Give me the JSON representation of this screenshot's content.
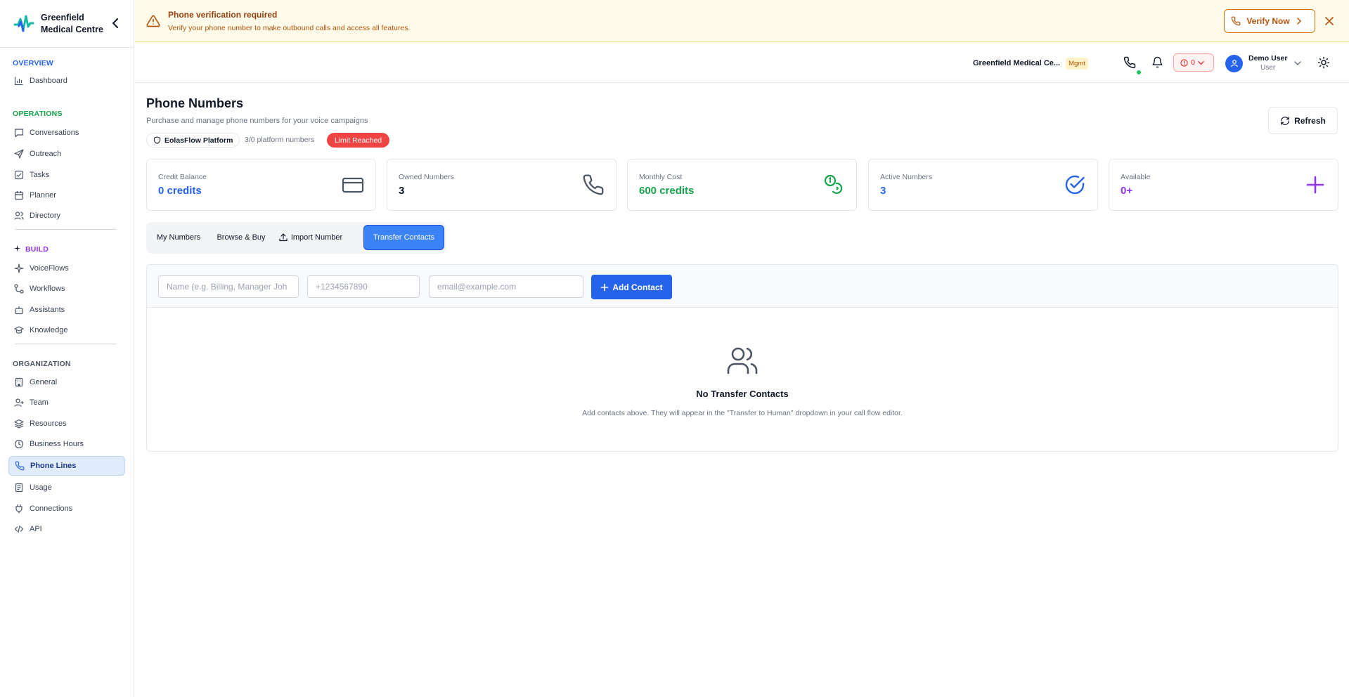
{
  "brand": {
    "name": "Greenfield Medical Centre"
  },
  "sidebar": {
    "sections": {
      "overview": {
        "label": "OVERVIEW",
        "color": "#2563eb"
      },
      "operations": {
        "label": "OPERATIONS",
        "color": "#16a34a"
      },
      "build": {
        "label": "BUILD",
        "color": "#9333ea"
      },
      "organization": {
        "label": "ORGANIZATION",
        "color": "#4b5563"
      }
    },
    "items": [
      {
        "label": "Dashboard",
        "icon": "chart-icon"
      },
      {
        "label": "Conversations",
        "icon": "message-icon"
      },
      {
        "label": "Outreach",
        "icon": "send-icon"
      },
      {
        "label": "Tasks",
        "icon": "checklist-icon"
      },
      {
        "label": "Planner",
        "icon": "calendar-icon"
      },
      {
        "label": "Directory",
        "icon": "users-icon"
      },
      {
        "label": "VoiceFlows",
        "icon": "sparkle-icon"
      },
      {
        "label": "Workflows",
        "icon": "workflow-icon"
      },
      {
        "label": "Assistants",
        "icon": "bot-icon"
      },
      {
        "label": "Knowledge",
        "icon": "graduation-icon"
      },
      {
        "label": "General",
        "icon": "building-icon"
      },
      {
        "label": "Team",
        "icon": "user-plus-icon"
      },
      {
        "label": "Resources",
        "icon": "layers-icon"
      },
      {
        "label": "Business Hours",
        "icon": "clock-icon"
      },
      {
        "label": "Phone Lines",
        "icon": "phone-icon",
        "active": true
      },
      {
        "label": "Usage",
        "icon": "receipt-icon"
      },
      {
        "label": "Connections",
        "icon": "plug-icon"
      },
      {
        "label": "API",
        "icon": "code-icon"
      }
    ]
  },
  "banner": {
    "title": "Phone verification required",
    "description": "Verify your phone number to make outbound calls and access all features.",
    "button": "Verify Now"
  },
  "header": {
    "org_name": "Greenfield Medical Ce...",
    "org_badge": "Mgmt",
    "alerts_count": "0",
    "user_name": "Demo User",
    "user_role": "User"
  },
  "page": {
    "title": "Phone Numbers",
    "subtitle": "Purchase and manage phone numbers for your voice campaigns",
    "platform_badge": "EolasFlow Platform",
    "platform_count": "3/0 platform numbers",
    "limit_badge": "Limit Reached",
    "refresh": "Refresh"
  },
  "stats": [
    {
      "label": "Credit Balance",
      "value": "0 credits",
      "color": "#2563eb",
      "icon": "credit-card-icon"
    },
    {
      "label": "Owned Numbers",
      "value": "3",
      "color": "#111827",
      "icon": "phone-icon"
    },
    {
      "label": "Monthly Cost",
      "value": "600 credits",
      "color": "#16a34a",
      "icon": "coins-icon"
    },
    {
      "label": "Active Numbers",
      "value": "3",
      "color": "#2563eb",
      "icon": "check-circle-icon"
    },
    {
      "label": "Available",
      "value": "0+",
      "color": "#9333ea",
      "icon": "plus-icon"
    }
  ],
  "tabs": [
    {
      "label": "My Numbers"
    },
    {
      "label": "Browse & Buy"
    },
    {
      "label": "Import Number"
    },
    {
      "label": "Transfer Contacts",
      "active": true
    }
  ],
  "contacts": {
    "name_placeholder": "Name (e.g. Billing, Manager Joh",
    "phone_placeholder": "+1234567890",
    "email_placeholder": "email@example.com",
    "add_button": "Add Contact",
    "empty_title": "No Transfer Contacts",
    "empty_description": "Add contacts above. They will appear in the \"Transfer to Human\" dropdown in your call flow editor."
  }
}
